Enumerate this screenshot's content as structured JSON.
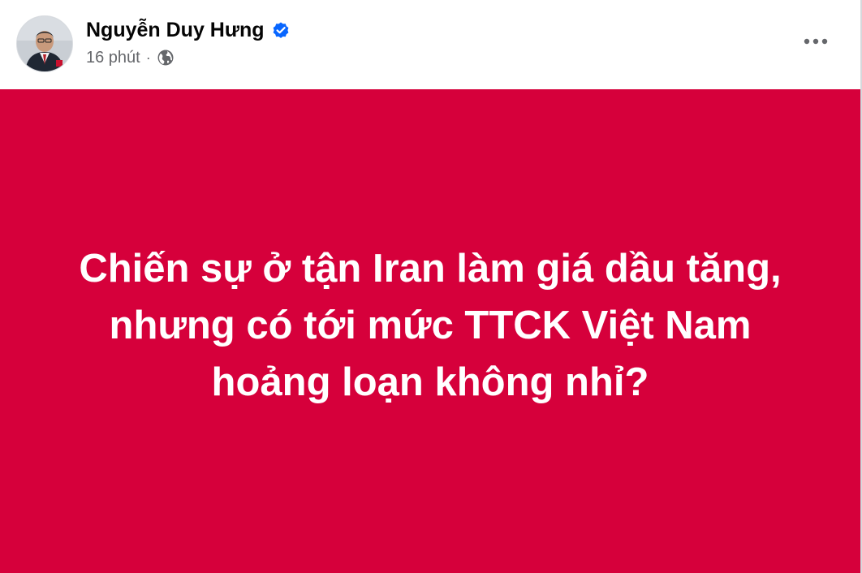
{
  "post": {
    "author": {
      "name": "Nguyễn Duy Hưng",
      "verified": true,
      "verified_icon": "verified-badge-icon",
      "avatar_icon": "profile-avatar"
    },
    "meta": {
      "time": "16 phút",
      "separator": "·",
      "privacy_icon": "globe-icon"
    },
    "more_options_icon": "more-horizontal-icon",
    "banner": {
      "background_color": "#d6003b",
      "text_color": "#ffffff",
      "lines": [
        "Chiến sự ở tận Iran làm giá dầu tăng,",
        "nhưng có tới mức TTCK Việt Nam",
        "hoảng loạn không nhỉ?"
      ]
    }
  },
  "colors": {
    "name_text": "#050505",
    "meta_text": "#65676b",
    "verified_blue": "#0866ff"
  }
}
